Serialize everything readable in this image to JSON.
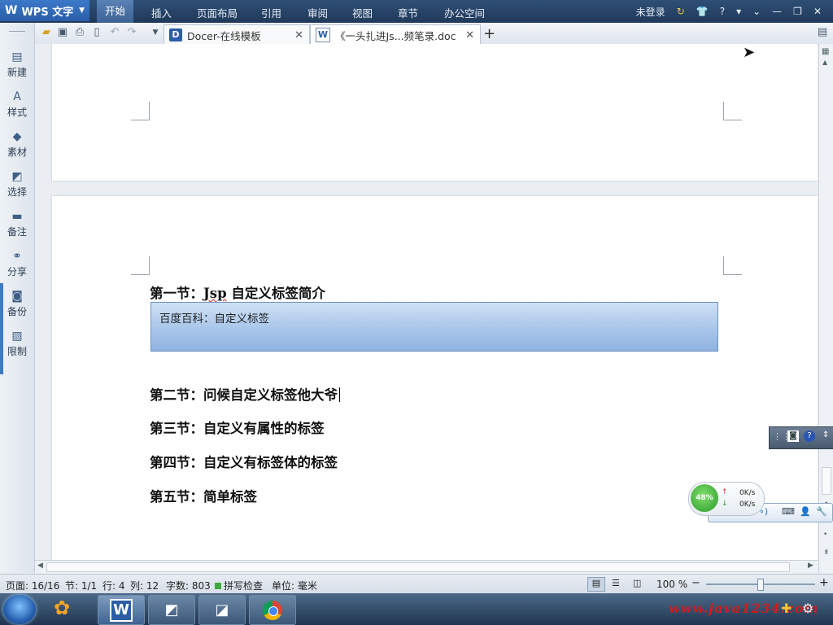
{
  "app": {
    "logo_text": "WPS 文字",
    "menu": [
      "开始",
      "插入",
      "页面布局",
      "引用",
      "审阅",
      "视图",
      "章节",
      "办公空间"
    ],
    "login_status": "未登录",
    "help_label": "?"
  },
  "tabs": [
    {
      "label": "Docer-在线模板",
      "icon": "docer-icon",
      "active": false
    },
    {
      "label": "《一头扎进Js...频笔录.doc",
      "icon": "word-doc-icon",
      "active": true
    }
  ],
  "sidebar": {
    "items": [
      {
        "label": "新建",
        "icon": "new-document-icon"
      },
      {
        "label": "样式",
        "icon": "style-icon"
      },
      {
        "label": "素材",
        "icon": "material-icon"
      },
      {
        "label": "选择",
        "icon": "select-icon"
      },
      {
        "label": "备注",
        "icon": "comment-icon"
      },
      {
        "label": "分享",
        "icon": "share-link-icon"
      },
      {
        "label": "备份",
        "icon": "backup-icon"
      },
      {
        "label": "限制",
        "icon": "restrict-icon"
      }
    ]
  },
  "document": {
    "heading1": {
      "prefix": "第一节：",
      "jsp": "Jsp",
      "rest": " 自定义标签简介"
    },
    "callout": "百度百科：自定义标签",
    "heading2": "第二节：问候自定义标签他大爷",
    "heading3": "第三节：自定义有属性的标签",
    "heading4": "第四节：自定义有标签体的标签",
    "heading5": "第五节：简单标签"
  },
  "status": {
    "page": "页面: 16/16",
    "section": "节: 1/1",
    "row": "行: 4",
    "col": "列: 12",
    "words": "字数: 803",
    "spell_check": "拼写检查",
    "unit": "单位: 毫米",
    "zoom": "100 %",
    "zoom_level_percent": 100
  },
  "speed_widget": {
    "percent": "48%",
    "upload": "0K/s",
    "download": "0K/s"
  },
  "watermark": "www.java1234.com",
  "colors": {
    "menu_bar": "#2a4468",
    "callout_fill": "#a8c6ea",
    "accent": "#3d7ac9"
  }
}
